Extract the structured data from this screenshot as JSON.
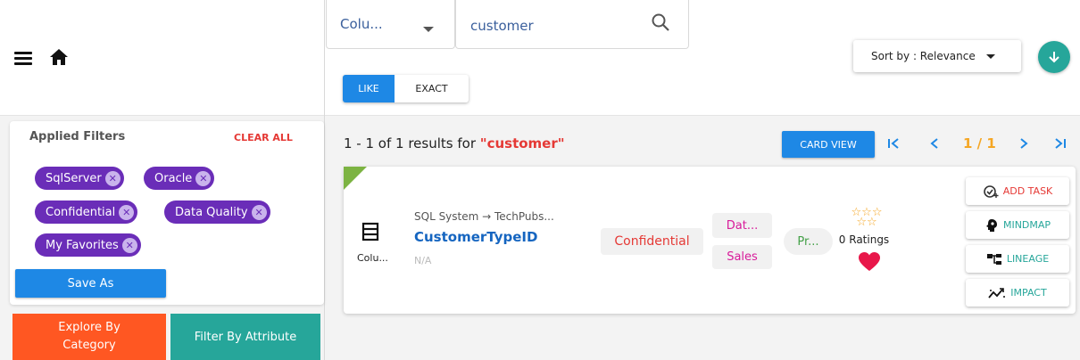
{
  "search": {
    "type_value": "Colu...",
    "query": "customer",
    "match_modes": [
      "LIKE",
      "EXACT"
    ],
    "active_mode": "LIKE"
  },
  "sort": {
    "label": "Sort by : Relevance"
  },
  "filters": {
    "title": "Applied Filters",
    "clear_label": "CLEAR ALL",
    "chips": [
      "SqlServer",
      "Oracle",
      "Confidential",
      "Data Quality",
      "My Favorites"
    ],
    "save_label": "Save As"
  },
  "side_buttons": {
    "explore": "Explore By Category",
    "filter_attr": "Filter By Attribute"
  },
  "results": {
    "prefix": "1 - 1 of 1 results for ",
    "query_quoted": "\"customer\"",
    "card_view_label": "CARD VIEW",
    "page_info": "1 / 1"
  },
  "card": {
    "type_label": "Colu...",
    "path": "SQL System → TechPubs...",
    "name": "CustomerTypeID",
    "description": "N/A",
    "classification": "Confidential",
    "domains": [
      "Dat...",
      "Sales"
    ],
    "status": "Pr...",
    "ratings_label": "0 Ratings",
    "rating": 0,
    "actions": [
      "ADD TASK",
      "MINDMAP",
      "LINEAGE",
      "IMPACT"
    ]
  },
  "colors": {
    "primary": "#1e88e5",
    "chip": "#6a2db8",
    "explore": "#ff5722",
    "teal": "#26a69a",
    "accent_red": "#e53935",
    "pager_info": "#f5a623"
  }
}
